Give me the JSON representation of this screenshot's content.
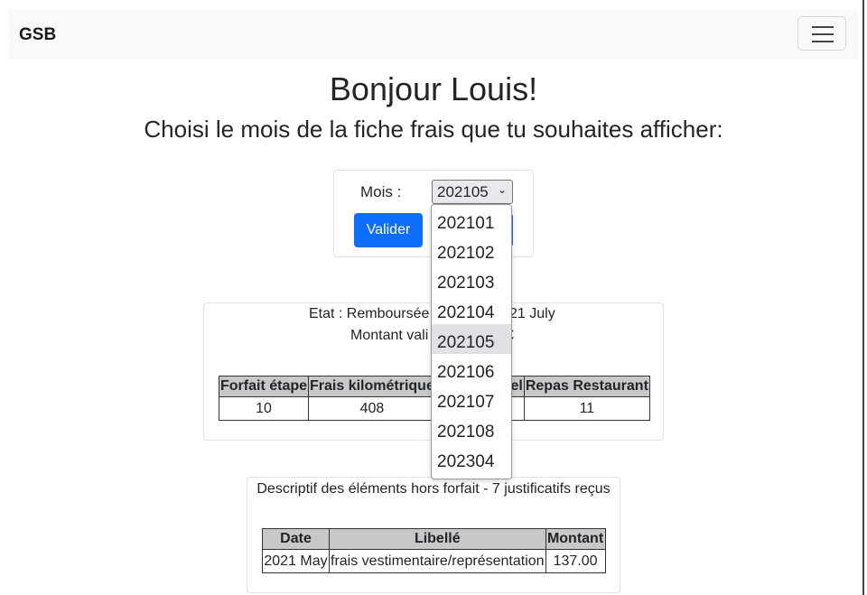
{
  "navbar": {
    "brand": "GSB",
    "toggler_icon": "hamburger-menu-icon"
  },
  "greeting": "Bonjour Louis!",
  "prompt": "Choisi le mois de la fiche frais que tu souhaites afficher:",
  "month_form": {
    "label": "Mois :",
    "selected": "202105",
    "options": [
      "202101",
      "202102",
      "202103",
      "202104",
      "202105",
      "202106",
      "202107",
      "202108",
      "202304"
    ],
    "submit_label": "Valider"
  },
  "fiche": {
    "state_line": "Etat : Remboursée depuis le 2021 July",
    "state_visible_left": "Etat : Remboursée",
    "state_visible_right": "21 July",
    "amount_visible": "Montant vali",
    "amount_visible_right": "€",
    "headers": [
      "Forfait étape",
      "Frais kilométrique",
      "",
      "Repas Restaurant"
    ],
    "header_partial_3": "el",
    "values": [
      "10",
      "408",
      "",
      "11"
    ]
  },
  "hors_forfait": {
    "caption": "Descriptif des éléments hors forfait - 7 justificatifs reçus",
    "headers": [
      "Date",
      "Libellé",
      "Montant"
    ],
    "rows": [
      [
        "2021 May",
        "frais vestimentaire/représentation",
        "137.00"
      ]
    ]
  },
  "colors": {
    "primary": "#0d6efd",
    "navbar_bg": "#f8f9fa",
    "table_header_bg": "#c8c8c8"
  }
}
